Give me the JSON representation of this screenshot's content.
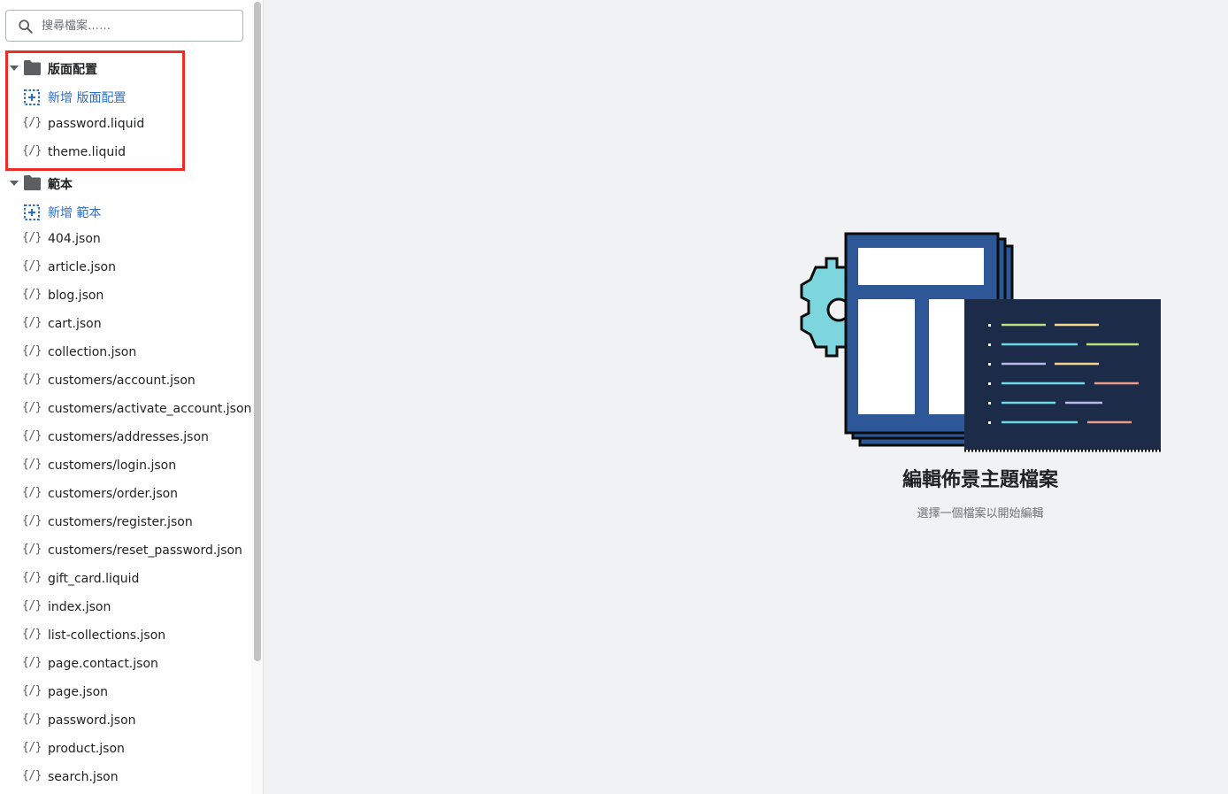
{
  "search": {
    "placeholder": "搜尋檔案……"
  },
  "tree": {
    "layout": {
      "label": "版面配置",
      "add_label": "新增 版面配置",
      "files": [
        "password.liquid",
        "theme.liquid"
      ]
    },
    "templates": {
      "label": "範本",
      "add_label": "新增 範本",
      "files": [
        "404.json",
        "article.json",
        "blog.json",
        "cart.json",
        "collection.json",
        "customers/account.json",
        "customers/activate_account.json",
        "customers/addresses.json",
        "customers/login.json",
        "customers/order.json",
        "customers/register.json",
        "customers/reset_password.json",
        "gift_card.liquid",
        "index.json",
        "list-collections.json",
        "page.contact.json",
        "page.json",
        "password.json",
        "product.json",
        "search.json"
      ]
    }
  },
  "empty_state": {
    "title": "編輯佈景主題檔案",
    "subtitle": "選擇一個檔案以開始編輯"
  },
  "icons": {
    "search": "search-icon",
    "folder": "folder-icon",
    "add": "add-file-icon",
    "code_file": "code-file-icon",
    "caret": "caret-down-icon"
  },
  "colors": {
    "link": "#2c6ecb",
    "highlight": "#ee2b24",
    "illustration_blue": "#2e5797",
    "illustration_navy": "#1b2b48",
    "illustration_teal": "#7dd6de"
  }
}
